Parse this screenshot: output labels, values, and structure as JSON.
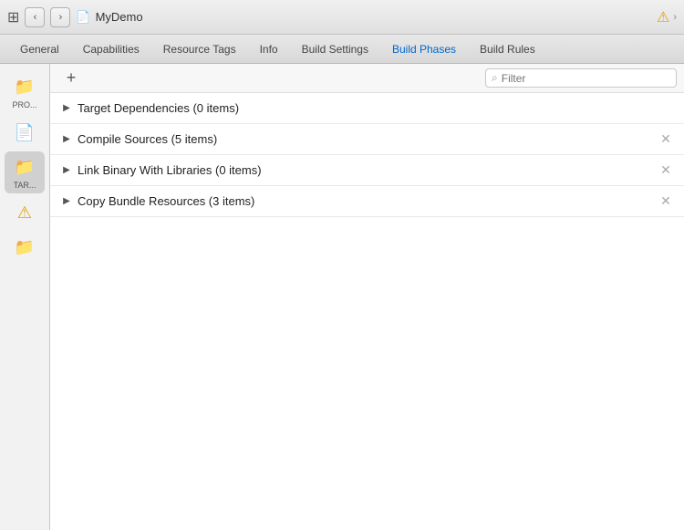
{
  "titleBar": {
    "gridIcon": "⊞",
    "navBack": "‹",
    "navForward": "›",
    "fileIcon": "📄",
    "title": "MyDemo",
    "warnIcon": "⚠",
    "chevronRight": "›"
  },
  "tabs": [
    {
      "id": "general",
      "label": "General",
      "active": false
    },
    {
      "id": "capabilities",
      "label": "Capabilities",
      "active": false
    },
    {
      "id": "resource-tags",
      "label": "Resource Tags",
      "active": false
    },
    {
      "id": "info",
      "label": "Info",
      "active": false
    },
    {
      "id": "build-settings",
      "label": "Build Settings",
      "active": false
    },
    {
      "id": "build-phases",
      "label": "Build Phases",
      "active": true
    },
    {
      "id": "build-rules",
      "label": "Build Rules",
      "active": false
    }
  ],
  "sidebar": {
    "items": [
      {
        "id": "project",
        "label": "PRO...",
        "icon": "📁"
      },
      {
        "id": "file",
        "label": "",
        "icon": "📄"
      },
      {
        "id": "target",
        "label": "TAR...",
        "icon": "📁"
      },
      {
        "id": "warning",
        "label": "",
        "icon": "⚠"
      },
      {
        "id": "folder2",
        "label": "",
        "icon": "📁"
      }
    ]
  },
  "toolbar": {
    "addButton": "+",
    "filter": {
      "icon": "⌕",
      "placeholder": "Filter"
    }
  },
  "phases": [
    {
      "id": "target-deps",
      "label": "Target Dependencies (0 items)",
      "hasClose": false
    },
    {
      "id": "compile-sources",
      "label": "Compile Sources (5 items)",
      "hasClose": true
    },
    {
      "id": "link-binary",
      "label": "Link Binary With Libraries (0 items)",
      "hasClose": true
    },
    {
      "id": "copy-bundle",
      "label": "Copy Bundle Resources (3 items)",
      "hasClose": true
    }
  ]
}
